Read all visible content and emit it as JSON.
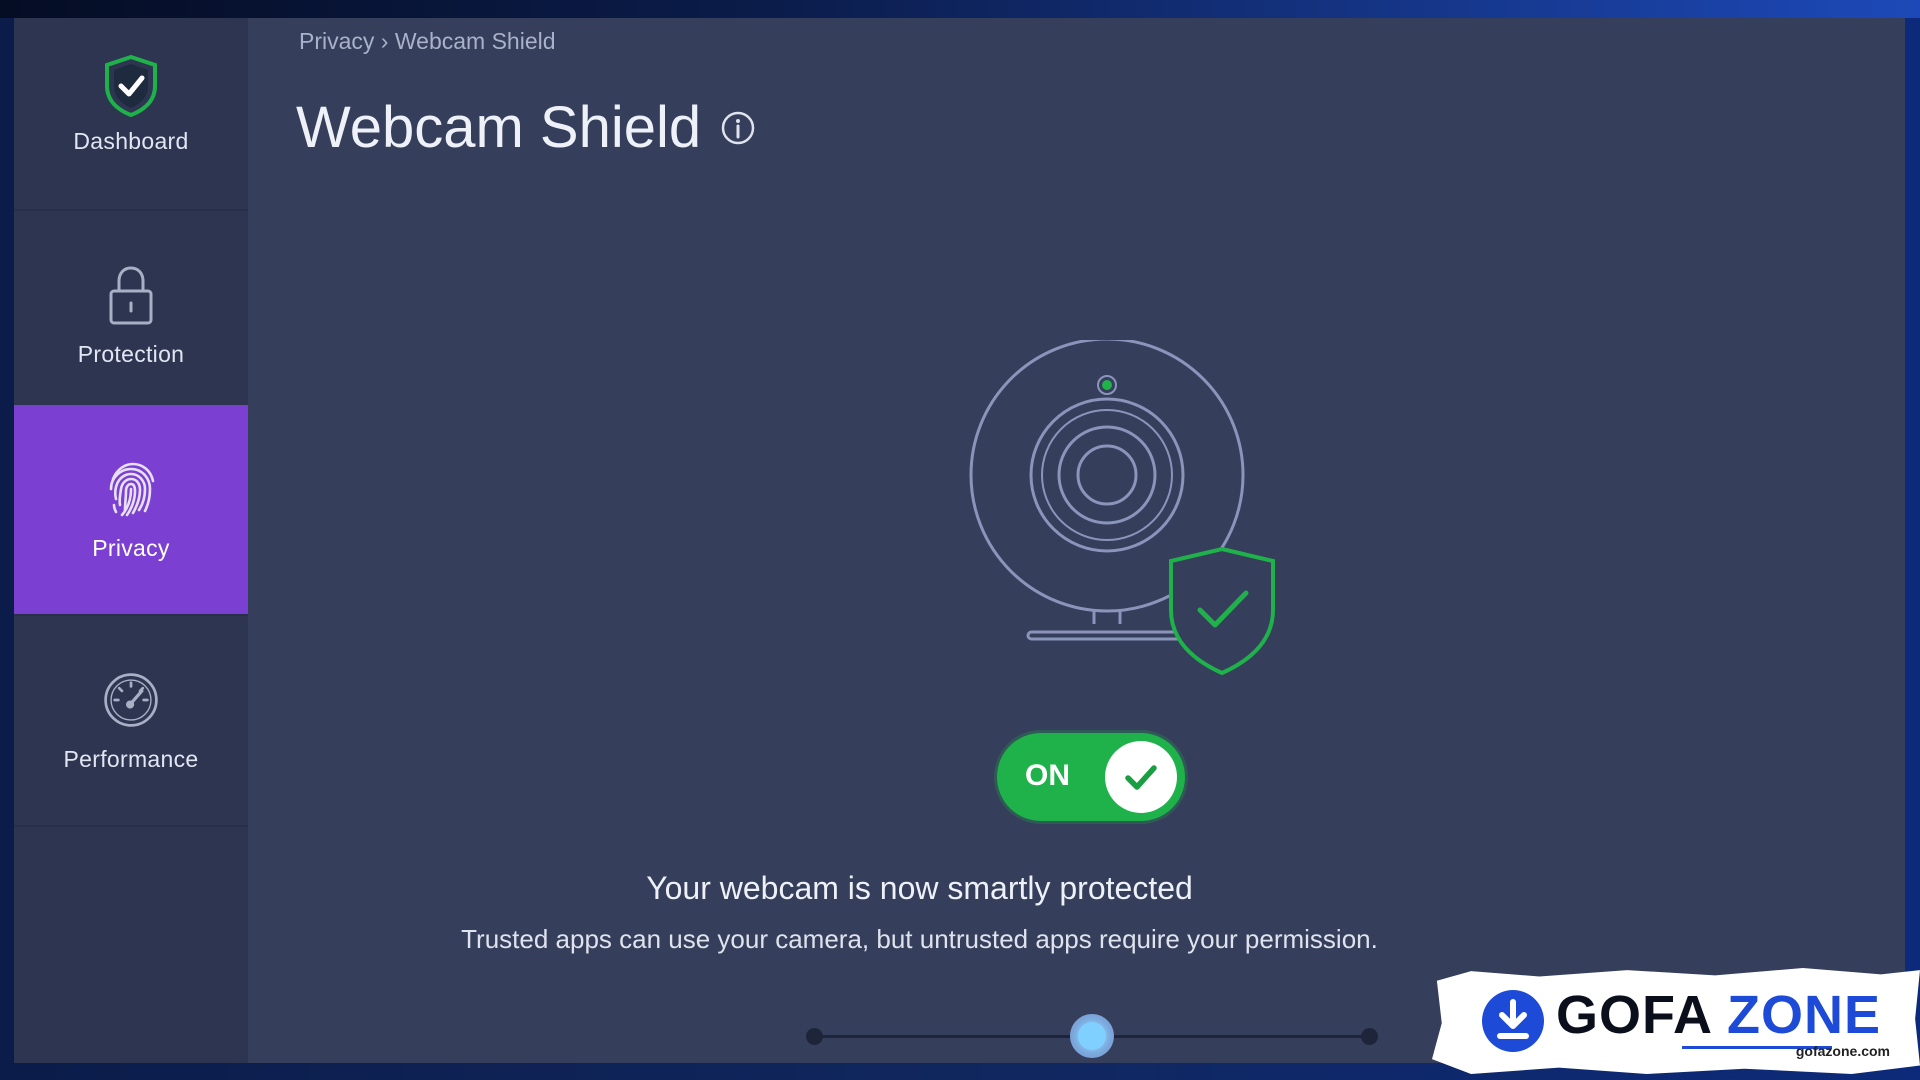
{
  "sidebar": {
    "items": [
      {
        "label": "Dashboard",
        "icon": "shield-check-icon",
        "active": false
      },
      {
        "label": "Protection",
        "icon": "lock-icon",
        "active": false
      },
      {
        "label": "Privacy",
        "icon": "fingerprint-icon",
        "active": true
      },
      {
        "label": "Performance",
        "icon": "speedometer-icon",
        "active": false
      }
    ]
  },
  "breadcrumb": {
    "parent": "Privacy",
    "separator": " › ",
    "current": "Webcam Shield"
  },
  "page": {
    "title": "Webcam Shield",
    "info_icon": "info-icon"
  },
  "toggle": {
    "label": "ON",
    "state": "on",
    "icon": "checkmark-icon"
  },
  "status": {
    "title": "Your webcam is now smartly protected",
    "description": "Trusted apps can use your camera, but untrusted apps require your permission."
  },
  "mode_slider": {
    "positions": 3,
    "selected_index": 1
  },
  "watermark": {
    "brand_part1": "GOFA",
    "brand_part2": "ZONE",
    "url": "gofazone.com",
    "icon": "download-icon"
  },
  "colors": {
    "accent_purple": "#7b3fd1",
    "toggle_green": "#1fb24a",
    "shield_green": "#1fb24a",
    "background": "#353e5a",
    "sidebar": "#2d3550"
  }
}
